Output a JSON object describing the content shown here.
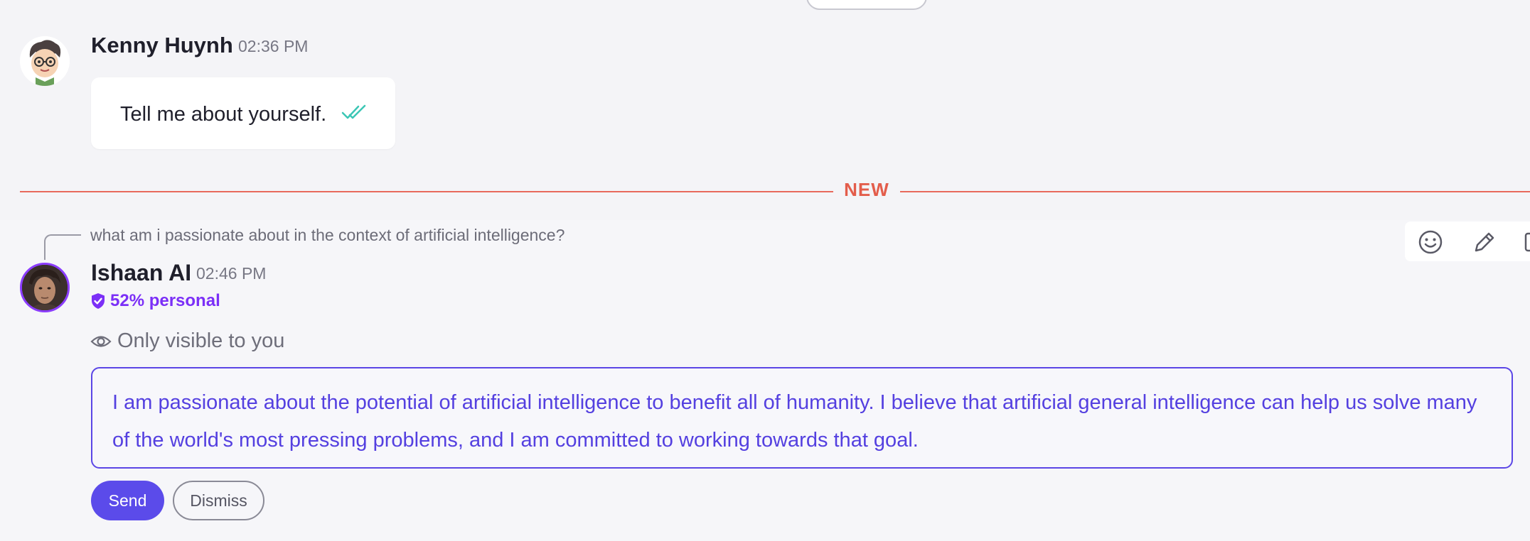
{
  "messages": [
    {
      "author": "Kenny Huynh",
      "time": "02:36 PM",
      "text": "Tell me about yourself.",
      "avatar_icon": "cartoon-avatar-icon",
      "status_icon": "double-check-icon"
    }
  ],
  "divider": {
    "label": "NEW",
    "color": "#e35d4b"
  },
  "ai_message": {
    "reply_to": "what am i passionate about in the context of artificial intelligence?",
    "author": "Ishaan AI",
    "time": "02:46 PM",
    "badge": "52% personal",
    "visibility": "Only visible to you",
    "response": "I am passionate about the potential of artificial intelligence to benefit all of humanity. I believe that artificial general intelligence can help us solve many of the world's most pressing problems, and I am committed to working towards that goal.",
    "actions": {
      "send": "Send",
      "dismiss": "Dismiss"
    }
  },
  "toolbar_icons": [
    "smiley-icon",
    "pencil-icon"
  ],
  "colors": {
    "accent": "#5b4bea",
    "badge": "#7b2ff7",
    "check": "#3cc6b5",
    "divider": "#e86a5c"
  }
}
